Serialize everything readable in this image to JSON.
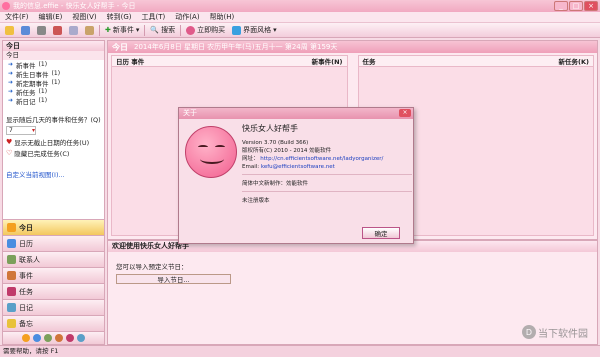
{
  "titlebar": {
    "title": "我的信息.effie - 快乐女人好帮手 - 今日"
  },
  "menu": [
    "文件(F)",
    "编辑(E)",
    "视图(V)",
    "转到(G)",
    "工具(T)",
    "动作(A)",
    "帮助(H)"
  ],
  "toolbar": {
    "new_event": "新事件",
    "search": "搜索",
    "buy_now": "立即购买",
    "ui_style": "界面风格"
  },
  "left": {
    "header": "今日",
    "subheader": "今日",
    "items": [
      {
        "label": "新事件",
        "count": "(1)"
      },
      {
        "label": "新生日事件",
        "count": "(1)"
      },
      {
        "label": "新定期事件",
        "count": "(1)"
      },
      {
        "label": "新任务",
        "count": "(1)"
      },
      {
        "label": "新日记",
        "count": "(1)"
      }
    ],
    "days_label": "显示随后几天的事件和任务？(Q)",
    "days_value": "7",
    "check_unset": "显示无截止日期的任务(U)",
    "check_hide": "隐藏已完成任务(C)",
    "custom_view": "自定义当前视图(I)..."
  },
  "nav": [
    "今日",
    "日历",
    "联系人",
    "事件",
    "任务",
    "日记",
    "备忘"
  ],
  "main": {
    "today_label": "今日",
    "date_text": "2014年6月8日 星期日 农历甲午年(马)五月十一 第24周 第159天",
    "events_pane": {
      "left": "日历 事件",
      "right": "新事件(N)"
    },
    "tasks_pane": {
      "left": "任务",
      "right": "新任务(K)"
    }
  },
  "welcome": {
    "header": "欢迎使用快乐女人好帮手",
    "text": "您可以导入预定义节日：",
    "import_button": "导入节日..."
  },
  "dialog": {
    "title": "关于",
    "app_name": "快乐女人好帮手",
    "version": "Version 3.70 (Build 366)",
    "copyright": "版权所有(C) 2010 - 2014 効能软件",
    "website_label": "网址：",
    "website": "http://cn.efficientsoftware.net/ladyorganizer/",
    "email_label": "Email:",
    "email": "kefu@efficientsoftware.net",
    "translator": "简体中文新制作：効能软件",
    "unregistered": "未注册版本",
    "ok_button": "确定"
  },
  "status": {
    "text": "需要帮助，请按 F1"
  },
  "watermark": {
    "text": "当下软件园"
  }
}
